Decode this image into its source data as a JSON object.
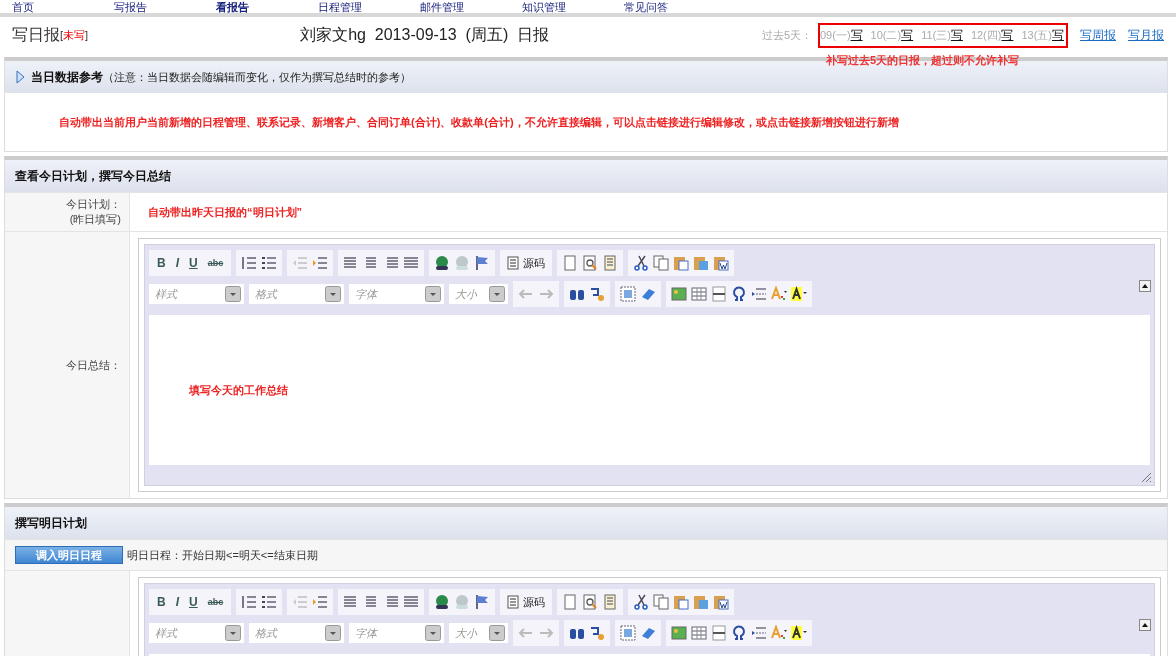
{
  "nav": [
    {
      "label": "首页",
      "selected": false
    },
    {
      "label": "写报告",
      "selected": false
    },
    {
      "label": "看报告",
      "selected": true
    },
    {
      "label": "日程管理",
      "selected": false
    },
    {
      "label": "邮件管理",
      "selected": false
    },
    {
      "label": "知识管理",
      "selected": false
    },
    {
      "label": "常见问答",
      "selected": false
    }
  ],
  "header": {
    "title": "写日报",
    "status_open": "[",
    "status": "未写",
    "status_close": "]",
    "report_title": "刘家文hg  2013-09-13  (周五)  日报",
    "past_label": "过去5天：",
    "past_days": [
      {
        "date": "09(一)",
        "action": "写"
      },
      {
        "date": "10(二)",
        "action": "写"
      },
      {
        "date": "11(三)",
        "action": "写"
      },
      {
        "date": "12(四)",
        "action": "写"
      },
      {
        "date": "13(五)",
        "action": "写"
      }
    ],
    "links": [
      "写周报",
      "写月报"
    ],
    "annotation": "补写过去5天的日报，超过则不允许补写"
  },
  "reference": {
    "title": "当日数据参考",
    "note": "（注意：当日数据会随编辑而变化，仅作为撰写总结时的参考）",
    "expanded": false,
    "annotation": "自动带出当前用户当前新增的日程管理、联系记录、新增客户、合同订单(合计)、收款单(合计)，不允许直接编辑，可以点击链接进行编辑修改，或点击链接新增按钮进行新增"
  },
  "today": {
    "title": "查看今日计划，撰写今日总结",
    "plan_label": "今日计划：",
    "plan_sublabel": "(昨日填写)",
    "plan_annotation": "自动带出昨天日报的“明日计划”",
    "summary_label": "今日总结：",
    "editor": {
      "format_buttons": [
        "B",
        "I",
        "U",
        "abc"
      ],
      "source_label": "源码",
      "dropdowns": [
        "样式",
        "格式",
        "字体",
        "大小"
      ],
      "content_annotation": "填写今天的工作总结"
    }
  },
  "tomorrow": {
    "title": "撰写明日计划",
    "import_button": "调入明日日程",
    "import_note": "明日日程：开始日期<=明天<=结束日期",
    "editor": {
      "format_buttons": [
        "B",
        "I",
        "U",
        "abc"
      ],
      "source_label": "源码",
      "dropdowns": [
        "样式",
        "格式",
        "字体",
        "大小"
      ]
    }
  }
}
